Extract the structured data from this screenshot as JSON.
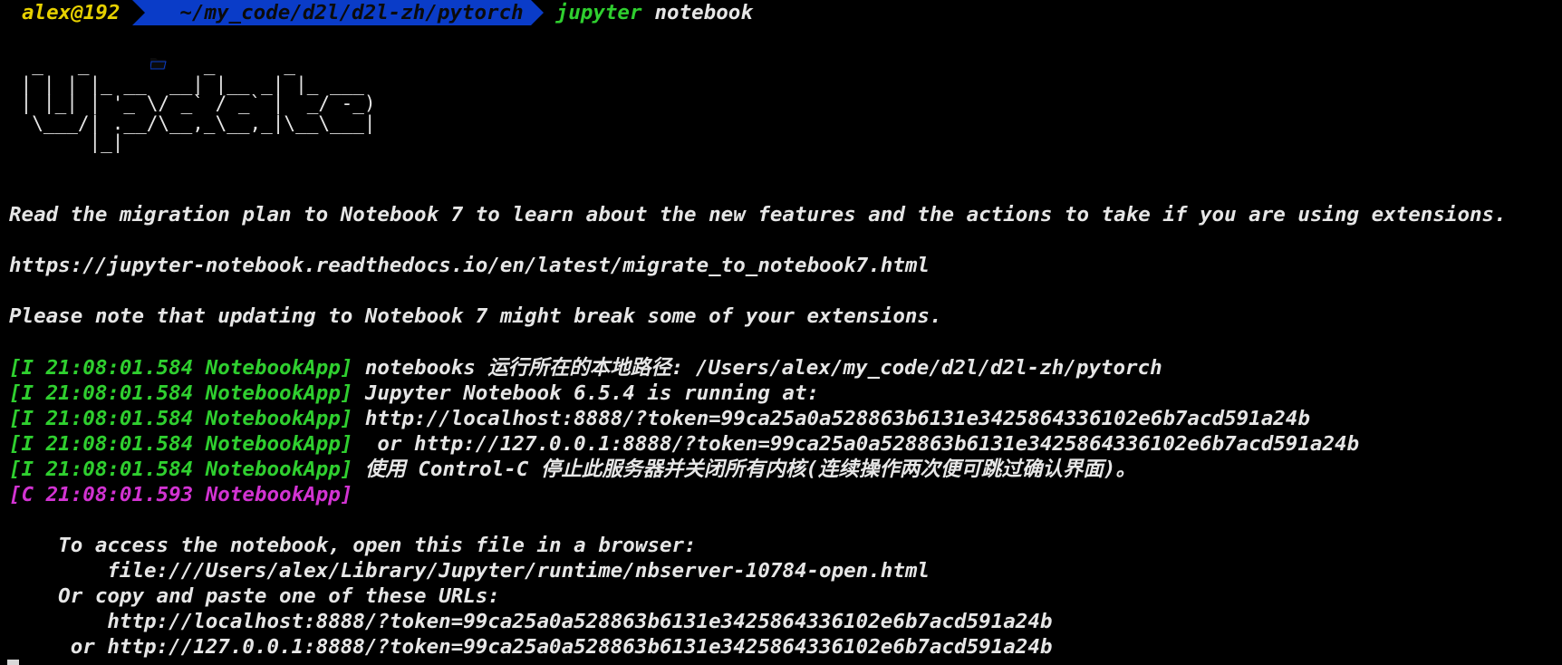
{
  "prompt": {
    "user": "alex@192",
    "path": "~/my_code/d2l/d2l-zh/pytorch",
    "command": "jupyter",
    "argument": "notebook"
  },
  "ascii_logo": "  _   _          _      _\n | | | |_ __  __| |__ _| |_ ___\n | |_| | '_ \\/ _` / _` |  _/ -_)\n  \\___/| .__/\\__,_\\__,_|\\__\\___|\n       |_|",
  "messages": {
    "migration": "Read the migration plan to Notebook 7 to learn about the new features and the actions to take if you are using extensions.",
    "migration_url": "https://jupyter-notebook.readthedocs.io/en/latest/migrate_to_notebook7.html",
    "note": "Please note that updating to Notebook 7 might break some of your extensions."
  },
  "log_lines": [
    {
      "tag": "[I 21:08:01.584 NotebookApp]",
      "level": "info",
      "text": " notebooks 运行所在的本地路径: /Users/alex/my_code/d2l/d2l-zh/pytorch"
    },
    {
      "tag": "[I 21:08:01.584 NotebookApp]",
      "level": "info",
      "text": " Jupyter Notebook 6.5.4 is running at:"
    },
    {
      "tag": "[I 21:08:01.584 NotebookApp]",
      "level": "info",
      "text": " http://localhost:8888/?token=99ca25a0a528863b6131e3425864336102e6b7acd591a24b"
    },
    {
      "tag": "[I 21:08:01.584 NotebookApp]",
      "level": "info",
      "text": "  or http://127.0.0.1:8888/?token=99ca25a0a528863b6131e3425864336102e6b7acd591a24b"
    },
    {
      "tag": "[I 21:08:01.584 NotebookApp]",
      "level": "info",
      "text": " 使用 Control-C 停止此服务器并关闭所有内核(连续操作两次便可跳过确认界面)。"
    },
    {
      "tag": "[C 21:08:01.593 NotebookApp]",
      "level": "critical",
      "text": ""
    }
  ],
  "access": {
    "intro": "    To access the notebook, open this file in a browser:",
    "file": "        file:///Users/alex/Library/Jupyter/runtime/nbserver-10784-open.html",
    "copy": "    Or copy and paste one of these URLs:",
    "url_local": "        http://localhost:8888/?token=99ca25a0a528863b6131e3425864336102e6b7acd591a24b",
    "url_ip": "     or http://127.0.0.1:8888/?token=99ca25a0a528863b6131e3425864336102e6b7acd591a24b"
  },
  "colors": {
    "background": "#000000",
    "user": "#e6d000",
    "path_bg": "#0a3cc8",
    "command": "#2fcf2f",
    "info_tag": "#2fcf2f",
    "critical_tag": "#d233d2",
    "text": "#e6e6e6"
  },
  "icons": {
    "path": "folder-icon"
  }
}
